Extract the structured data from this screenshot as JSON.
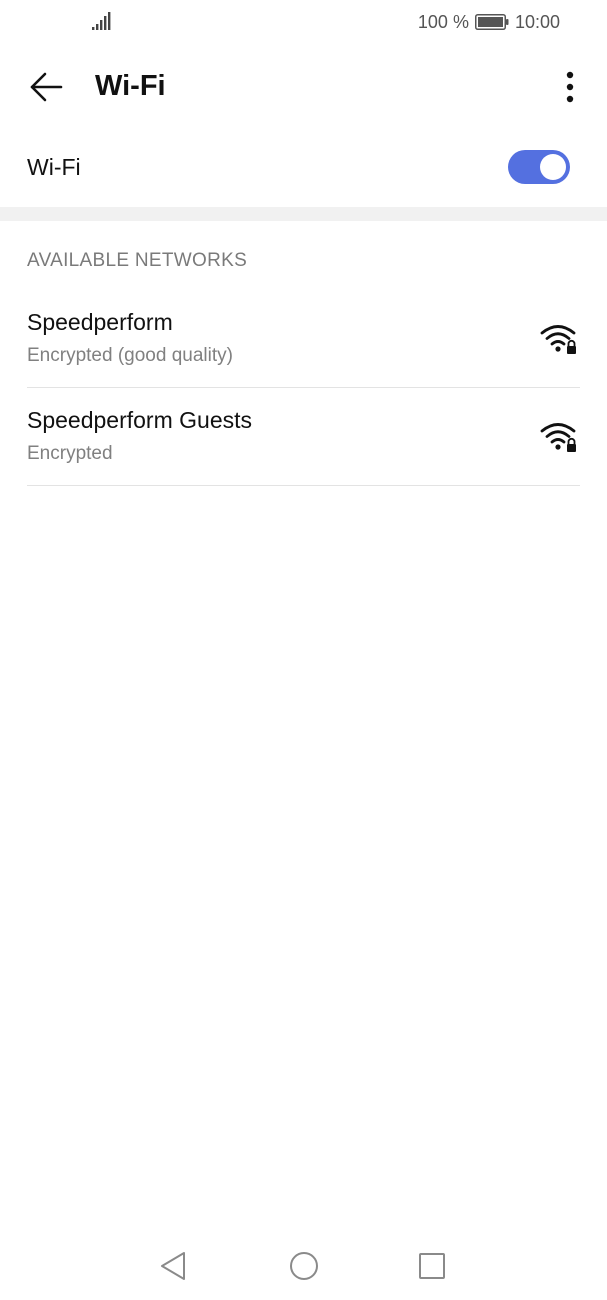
{
  "status_bar": {
    "battery_percent": "100 %",
    "time": "10:00",
    "signal_icon": "signal-bars-icon",
    "battery_icon": "battery-full-icon",
    "battery_level": 1.0
  },
  "app_bar": {
    "back_icon": "arrow-left-icon",
    "title": "Wi-Fi",
    "more_icon": "more-vertical-icon"
  },
  "wifi_toggle": {
    "label": "Wi-Fi",
    "enabled": true,
    "accent_color": "#5470e0"
  },
  "networks_section": {
    "header": "AVAILABLE NETWORKS",
    "items": [
      {
        "name": "Speedperform",
        "status": "Encrypted (good quality)",
        "icon": "wifi-locked-icon"
      },
      {
        "name": "Speedperform Guests",
        "status": "Encrypted",
        "icon": "wifi-locked-icon"
      }
    ]
  },
  "nav_bar": {
    "back_icon": "triangle-back-icon",
    "home_icon": "circle-home-icon",
    "recents_icon": "square-recents-icon"
  }
}
